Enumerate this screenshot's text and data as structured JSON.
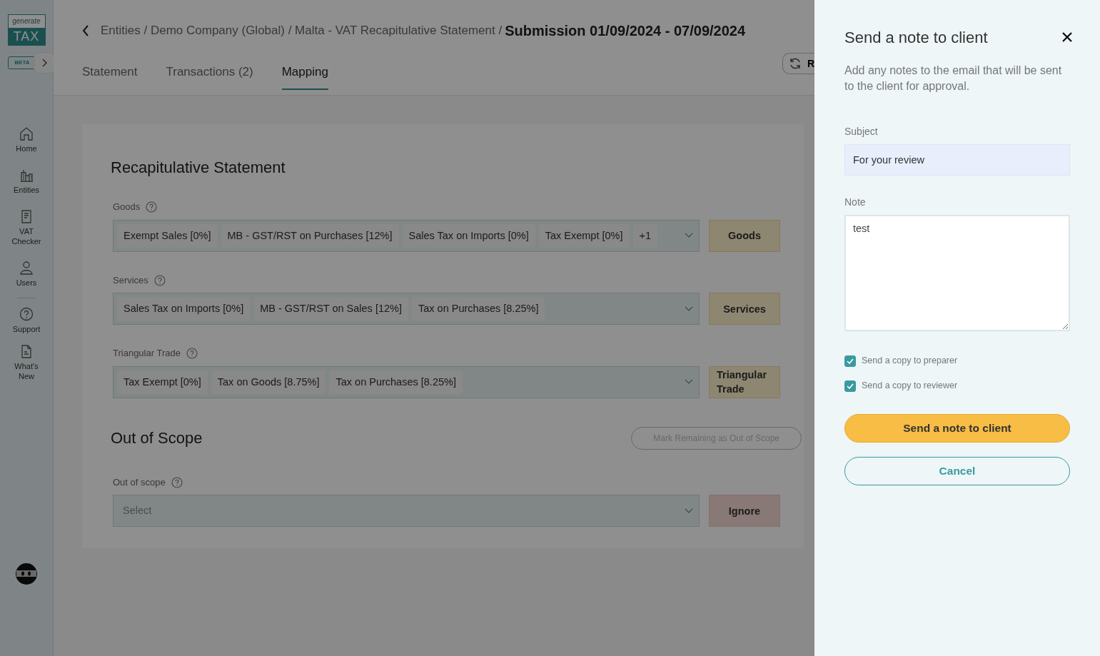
{
  "sidebar": {
    "logo": {
      "top": "generate",
      "bottom": "TAX",
      "badge": "BETA"
    },
    "items": [
      {
        "label": "Home"
      },
      {
        "label": "Entities"
      },
      {
        "label": "VAT Checker"
      },
      {
        "label": "Users"
      }
    ],
    "bottom_items": [
      {
        "label": "Support"
      },
      {
        "label": "What's New"
      }
    ]
  },
  "breadcrumb": {
    "path": "Entities / Demo Company (Global) / Malta - VAT Recapitulative Statement /",
    "current": "Submission 01/09/2024 - 07/09/2024"
  },
  "tabs": [
    {
      "label": "Statement",
      "selected": false
    },
    {
      "label": "Transactions (2)",
      "selected": false
    },
    {
      "label": "Mapping",
      "selected": true
    }
  ],
  "refresh_button": {
    "label": "R"
  },
  "recap": {
    "title": "Recapitulative Statement",
    "groups": [
      {
        "label": "Goods",
        "tags": [
          "Exempt Sales [0%]",
          "MB - GST/RST on Purchases [12%]",
          "Sales Tax on Imports [0%]",
          "Tax Exempt [0%]"
        ],
        "more": "+1",
        "button": "Goods"
      },
      {
        "label": "Services",
        "tags": [
          "Sales Tax on Imports [0%]",
          "MB - GST/RST on Sales [12%]",
          "Tax on Purchases [8.25%]"
        ],
        "button": "Services"
      },
      {
        "label": "Triangular Trade",
        "tags": [
          "Tax Exempt [0%]",
          "Tax on Goods [8.75%]",
          "Tax on Purchases [8.25%]"
        ],
        "button": "Triangular Trade"
      }
    ]
  },
  "out_of_scope": {
    "title": "Out of Scope",
    "action": {
      "label": "Mark Remaining as Out of Scope",
      "disabled": true
    },
    "label": "Out of scope",
    "placeholder": "Select",
    "button": "Ignore"
  },
  "drawer": {
    "title": "Send a note to client",
    "description": "Add any notes to the email that will be sent to the client for approval.",
    "subject_label": "Subject",
    "subject": "For your review",
    "note_label": "Note",
    "note": "test",
    "checkboxes": [
      {
        "label": "Send a copy to preparer",
        "checked": true
      },
      {
        "label": "Send a copy to reviewer",
        "checked": true
      }
    ],
    "submit": "Send a note to client",
    "cancel": "Cancel"
  }
}
